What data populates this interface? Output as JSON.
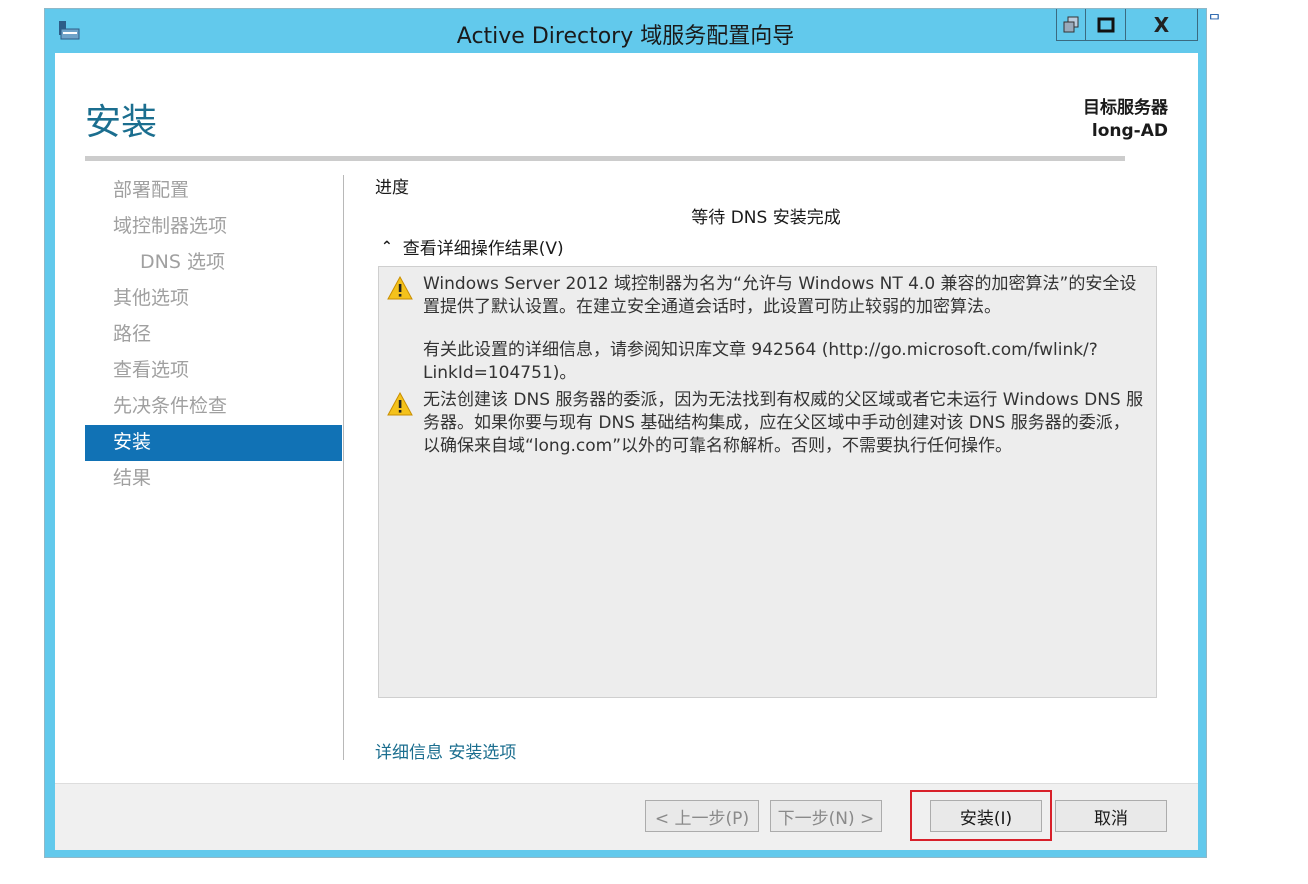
{
  "window": {
    "title": "Active Directory 域服务配置向导",
    "controls": {
      "restore": "",
      "maximize": "",
      "close": "X"
    }
  },
  "outside_glyph": "ᄆ",
  "header": {
    "page_title": "安装",
    "target_label": "目标服务器",
    "target_name": "long-AD"
  },
  "nav": {
    "items": [
      {
        "label": "部署配置"
      },
      {
        "label": "域控制器选项"
      },
      {
        "label": "DNS 选项"
      },
      {
        "label": "其他选项"
      },
      {
        "label": "路径"
      },
      {
        "label": "查看选项"
      },
      {
        "label": "先决条件检查"
      },
      {
        "label": "安装"
      },
      {
        "label": "结果"
      }
    ],
    "active": "安装"
  },
  "content": {
    "progress_label": "进度",
    "status": "等待 DNS 安装完成",
    "toggle_label": "查看详细操作结果(V)",
    "messages": [
      {
        "icon": "warning-icon",
        "paragraphs": [
          "Windows Server 2012 域控制器为名为“允许与 Windows NT 4.0 兼容的加密算法”的安全设置提供了默认设置。在建立安全通道会话时，此设置可防止较弱的加密算法。",
          "有关此设置的详细信息，请参阅知识库文章 942564 (http://go.microsoft.com/fwlink/?LinkId=104751)。"
        ]
      },
      {
        "icon": "warning-icon",
        "paragraphs": [
          "无法创建该 DNS 服务器的委派，因为无法找到有权威的父区域或者它未运行 Windows DNS 服务器。如果你要与现有 DNS 基础结构集成，应在父区域中手动创建对该 DNS 服务器的委派，以确保来自域“long.com”以外的可靠名称解析。否则，不需要执行任何操作。"
        ]
      }
    ],
    "more_link": "详细信息 安装选项"
  },
  "footer": {
    "prev": "< 上一步(P)",
    "next": "下一步(N) >",
    "install": "安装(I)",
    "cancel": "取消"
  },
  "colors": {
    "title_bar": "#62c9ec",
    "accent": "#1172b5",
    "highlight_border": "#d8202a"
  }
}
